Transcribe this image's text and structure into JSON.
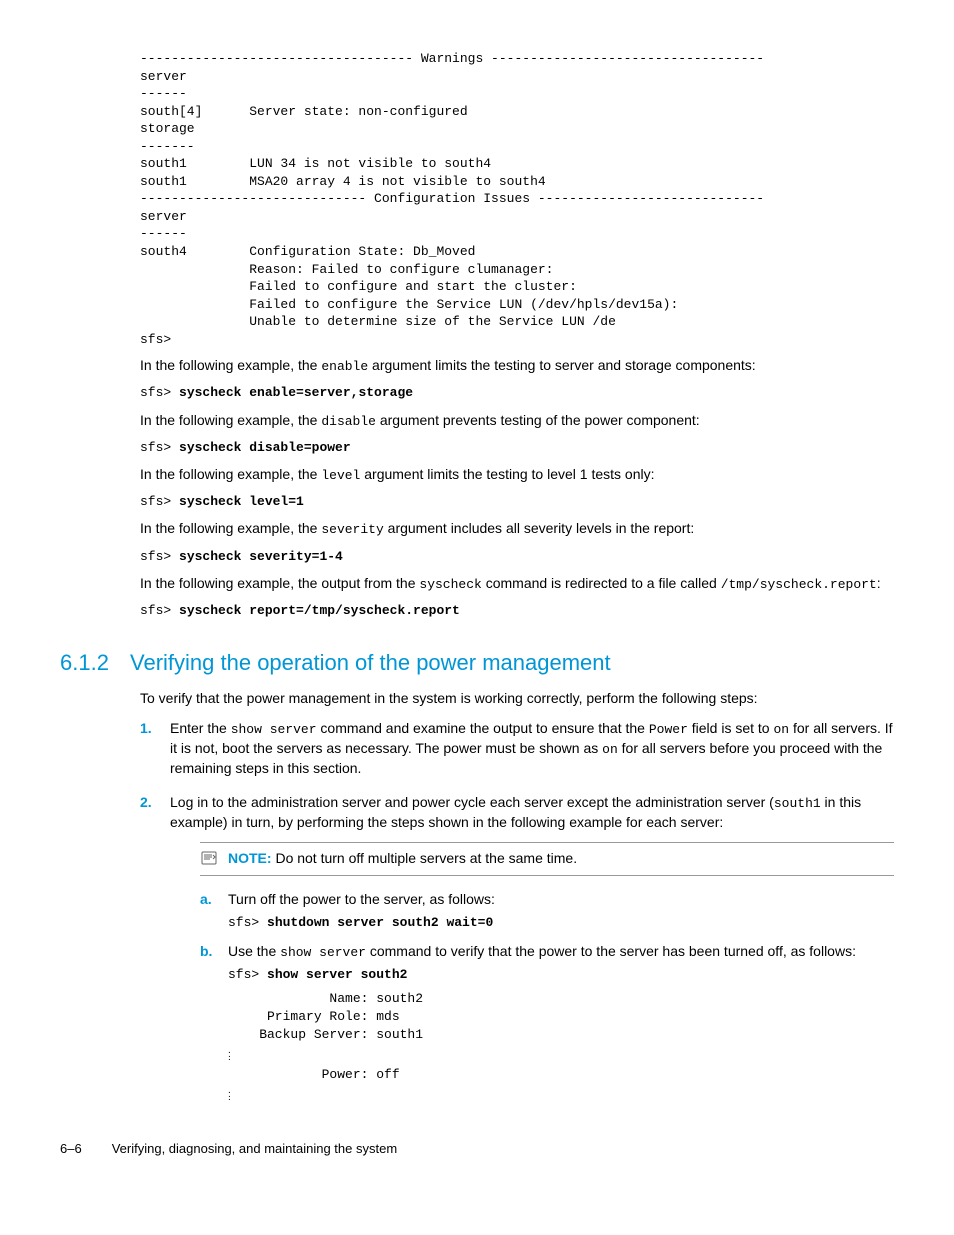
{
  "output_block": "----------------------------------- Warnings -----------------------------------\nserver\n------\nsouth[4]      Server state: non-configured\nstorage\n-------\nsouth1        LUN 34 is not visible to south4\nsouth1        MSA20 array 4 is not visible to south4\n----------------------------- Configuration Issues -----------------------------\nserver\n------\nsouth4        Configuration State: Db_Moved\n              Reason: Failed to configure clumanager:\n              Failed to configure and start the cluster:\n              Failed to configure the Service LUN (/dev/hpls/dev15a):\n              Unable to determine size of the Service LUN /de\nsfs>",
  "para1_a": "In the following example, the ",
  "para1_code": "enable",
  "para1_b": " argument limits the testing to server and storage components:",
  "cmd1_prompt": "sfs> ",
  "cmd1": "syscheck enable=server,storage",
  "para2_a": "In the following example, the ",
  "para2_code": "disable",
  "para2_b": " argument prevents testing of the power component:",
  "cmd2_prompt": "sfs> ",
  "cmd2": "syscheck disable=power",
  "para3_a": "In the following example, the ",
  "para3_code": "level",
  "para3_b": " argument limits the testing to level 1 tests only:",
  "cmd3_prompt": "sfs> ",
  "cmd3": "syscheck level=1",
  "para4_a": "In the following example, the ",
  "para4_code": "severity",
  "para4_b": " argument includes all severity levels in the report:",
  "cmd4_prompt": "sfs> ",
  "cmd4": "syscheck severity=1-4",
  "para5_a": "In the following example, the output from the ",
  "para5_code": "syscheck",
  "para5_b": " command is redirected to a file called ",
  "para5_code2": "/tmp/syscheck.report",
  "para5_c": ":",
  "cmd5_prompt": "sfs> ",
  "cmd5": "syscheck report=/tmp/syscheck.report",
  "section_num": "6.1.2",
  "section_title": "Verifying the operation of the power management",
  "intro": "To verify that the power management in the system is working correctly, perform the following steps:",
  "step1_marker": "1.",
  "step1_a": "Enter the ",
  "step1_code1": "show server",
  "step1_b": " command and examine the output to ensure that the ",
  "step1_code2": "Power",
  "step1_c": " field is set to ",
  "step1_code3": "on",
  "step1_d": " for all servers. If it is not, boot the servers as necessary. The power must be shown as ",
  "step1_code4": "on",
  "step1_e": " for all servers before you proceed with the remaining steps in this section.",
  "step2_marker": "2.",
  "step2_a": "Log in to the administration server and power cycle each server except the administration server (",
  "step2_code1": "south1",
  "step2_b": " in this example) in turn, by performing the steps shown in the following example for each server:",
  "note_label": "NOTE:",
  "note_text": "  Do not turn off multiple servers at the same time.",
  "sub_a_marker": "a.",
  "sub_a_text": "Turn off the power to the server, as follows:",
  "sub_a_prompt": "sfs> ",
  "sub_a_cmd": "shutdown server south2 wait=0",
  "sub_b_marker": "b.",
  "sub_b_a": "Use the ",
  "sub_b_code": "show server",
  "sub_b_b": " command to verify that the power to the server has been turned off, as follows:",
  "sub_b_prompt": "sfs> ",
  "sub_b_cmd": "show server south2",
  "sub_b_output1": "             Name: south2\n     Primary Role: mds\n    Backup Server: south1",
  "sub_b_output2": "            Power: off",
  "footer_page": "6–6",
  "footer_text": "Verifying, diagnosing, and maintaining the system"
}
